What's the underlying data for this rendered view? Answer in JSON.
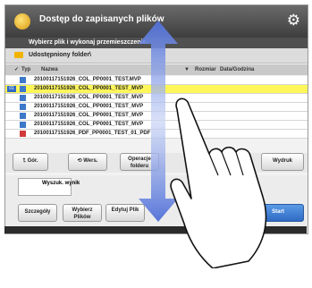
{
  "window": {
    "title": "Dostęp do zapisanych plików",
    "gear_icon": "gear-icon"
  },
  "header": {
    "instruction": "Wybierz plik i wykonaj przemieszczenie."
  },
  "location": {
    "folder_icon": "folder-icon",
    "path": "Udostępniony folder\\"
  },
  "table": {
    "columns": [
      "Typ",
      "Nazwa",
      "Rozmiar",
      "Data/Godzina"
    ],
    "rows": [
      {
        "type": "doc",
        "name": "20100117151926_COL_PP0001_TEST.MVP",
        "selected": false
      },
      {
        "type": "doc",
        "name": "20100117151926_COL_PP0001_TEST_MVP",
        "selected": true,
        "badge": "01"
      },
      {
        "type": "doc",
        "name": "20100117151926_COL_PP0001_TEST_MVP",
        "selected": false
      },
      {
        "type": "doc",
        "name": "20100117151926_COL_PP0001_TEST_MVP",
        "selected": false
      },
      {
        "type": "doc",
        "name": "20100117151926_COL_PP0001_TEST_MVP",
        "selected": false
      },
      {
        "type": "doc",
        "name": "20100117151926_COL_PP0001_TEST_MVP",
        "selected": false
      },
      {
        "type": "pdf",
        "name": "20100117151926_PDF_PP0001_TEST_01_PDF",
        "selected": false
      }
    ]
  },
  "toolbar": {
    "up_label": "Gór.",
    "back_label": "Wers.",
    "folder_ops_label": "Operacje folderu",
    "print_label": "Wydruk"
  },
  "preview": {
    "label": "Wyszuk. wynik"
  },
  "actions": {
    "settings_label": "Szczegóły",
    "file_select_label": "Wybierz Plików",
    "file_ops_label": "Edytuj Plik",
    "start_label": "Start"
  }
}
